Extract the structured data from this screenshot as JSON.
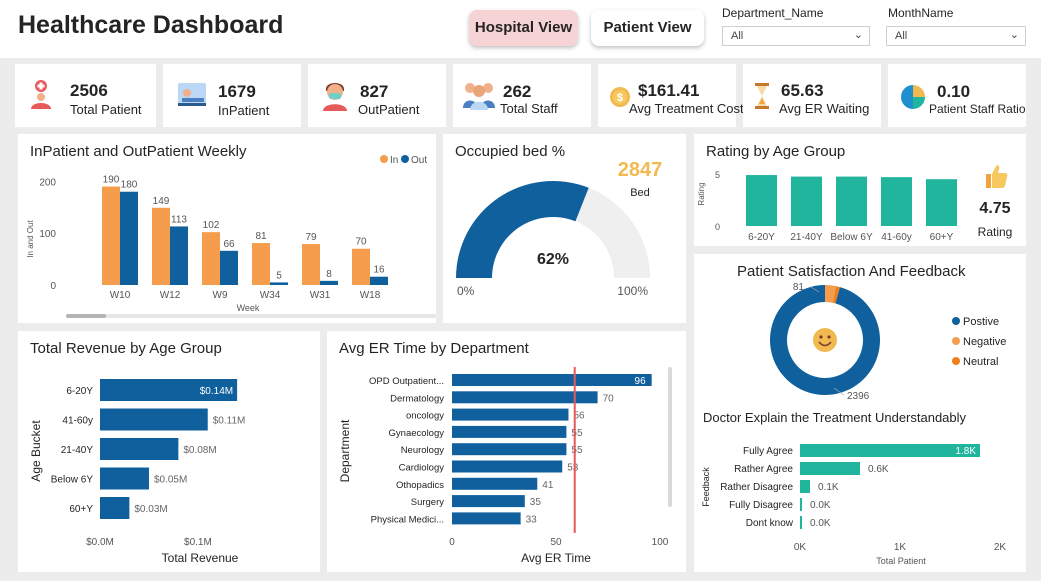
{
  "header": {
    "title": "Healthcare Dashboard",
    "hospital_view_label": "Hospital View",
    "patient_view_label": "Patient View",
    "department_label": "Department_Name",
    "department_value": "All",
    "month_label": "MonthName",
    "month_value": "All"
  },
  "kpis": [
    {
      "value": "2506",
      "label": "Total Patient",
      "icon": "patient-add-icon"
    },
    {
      "value": "1679",
      "label": "InPatient",
      "icon": "hospital-bed-icon"
    },
    {
      "value": "827",
      "label": "OutPatient",
      "icon": "masked-person-icon"
    },
    {
      "value": "262",
      "label": "Total Staff",
      "icon": "staff-group-icon"
    },
    {
      "value": "$161.41",
      "label": "Avg Treatment Cost",
      "icon": "coin-icon"
    },
    {
      "value": "65.63",
      "label": "Avg ER Waiting",
      "icon": "hourglass-icon"
    },
    {
      "value": "0.10",
      "label": "Patient Staff Ratio",
      "icon": "pie-ratio-icon"
    }
  ],
  "colors": {
    "orange": "#f59d4c",
    "blue": "#11609e",
    "teal": "#21b59e",
    "red_line": "#e8595a",
    "gold": "#f2b950"
  },
  "weekly": {
    "title": "InPatient and OutPatient Weekly",
    "legend_in": "In",
    "legend_out": "Out",
    "chart_data": {
      "type": "bar",
      "categories": [
        "W10",
        "W12",
        "W9",
        "W34",
        "W31",
        "W18"
      ],
      "series": [
        {
          "name": "In",
          "values": [
            190,
            149,
            102,
            81,
            79,
            70
          ]
        },
        {
          "name": "Out",
          "values": [
            180,
            113,
            66,
            5,
            8,
            16
          ]
        }
      ],
      "xlabel": "Week",
      "ylabel": "In and Out",
      "yticks": [
        "0",
        "100",
        "200"
      ],
      "ylim": [
        0,
        220
      ]
    }
  },
  "bed": {
    "title": "Occupied bed %",
    "bed_count": "2847",
    "bed_label": "Bed",
    "percent_label": "62%",
    "fill": 0.62,
    "min_label": "0%",
    "max_label": "100%"
  },
  "rating": {
    "title": "Rating by Age Group",
    "value": "4.75",
    "value_label": "Rating",
    "chart_data": {
      "type": "bar",
      "categories": [
        "6-20Y",
        "21-40Y",
        "Below 6Y",
        "41-60y",
        "60+Y"
      ],
      "values": [
        4.9,
        4.75,
        4.75,
        4.7,
        4.5
      ],
      "ylabel": "Rating",
      "yticks": [
        "0",
        "5"
      ],
      "ylim": [
        0,
        5
      ]
    }
  },
  "satisfaction": {
    "title": "Patient Satisfaction And Feedback",
    "legend": [
      "Postive",
      "Negative",
      "Neutral"
    ],
    "chart_data": {
      "type": "pie",
      "labels": [
        "Postive",
        "Negative",
        "Neutral"
      ],
      "values": [
        2396,
        81,
        29
      ],
      "data_labels": [
        "2396",
        "81"
      ]
    }
  },
  "revenue": {
    "title": "Total Revenue by Age Group",
    "chart_data": {
      "type": "bar",
      "categories": [
        "6-20Y",
        "41-60y",
        "21-40Y",
        "Below 6Y",
        "60+Y"
      ],
      "values": [
        0.14,
        0.11,
        0.08,
        0.05,
        0.03
      ],
      "data_labels": [
        "$0.14M",
        "$0.11M",
        "$0.08M",
        "$0.05M",
        "$0.03M"
      ],
      "xlabel": "Total Revenue",
      "ylabel": "Age Bucket",
      "xticks": [
        "$0.0M",
        "$0.1M"
      ],
      "xlim": [
        0,
        0.17
      ]
    }
  },
  "er": {
    "title": "Avg ER Time by Department",
    "chart_data": {
      "type": "bar",
      "categories": [
        "OPD Outpatient...",
        "Dermatology",
        "oncology",
        "Gynaecology",
        "Neurology",
        "Cardiology",
        "Othopadics",
        "Surgery",
        "Physical Medici..."
      ],
      "values": [
        96,
        70,
        56,
        55,
        55,
        53,
        41,
        35,
        33
      ],
      "xlabel": "Avg ER Time",
      "ylabel": "Department",
      "xticks": [
        "0",
        "50",
        "100"
      ],
      "xlim": [
        0,
        100
      ],
      "reference_line": 59
    }
  },
  "doctor": {
    "title": "Doctor Explain the Treatment Understandably",
    "chart_data": {
      "type": "bar",
      "categories": [
        "Fully Agree",
        "Rather Agree",
        "Rather Disagree",
        "Fully Disagree",
        "Dont know"
      ],
      "values": [
        1.8,
        0.6,
        0.1,
        0.0,
        0.0
      ],
      "data_labels": [
        "1.8K",
        "0.6K",
        "0.1K",
        "0.0K",
        "0.0K"
      ],
      "xlabel": "Total Patient",
      "ylabel": "Feedback",
      "xticks": [
        "0K",
        "1K",
        "2K"
      ],
      "xlim": [
        0,
        2
      ]
    }
  }
}
